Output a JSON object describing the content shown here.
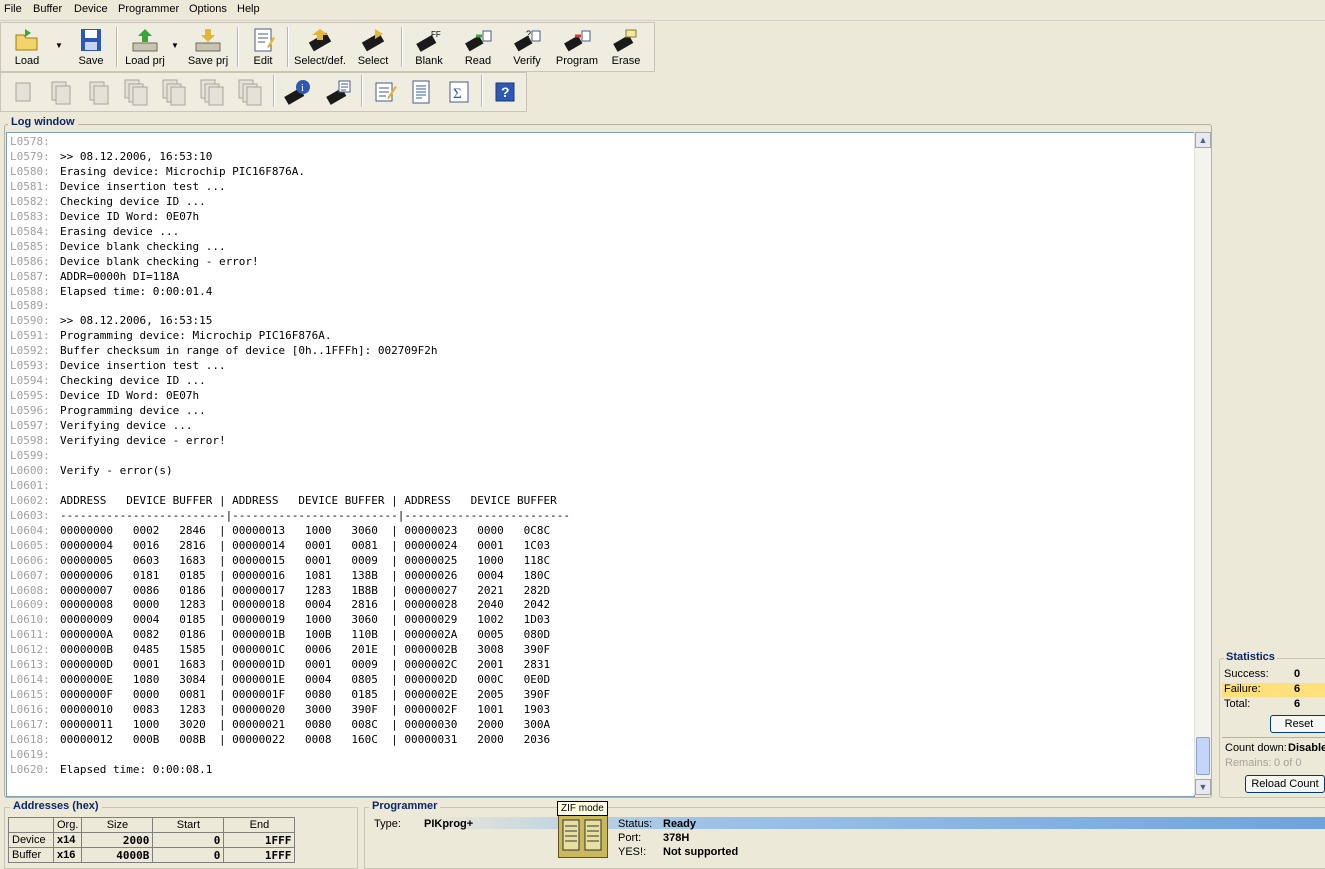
{
  "menu": [
    "File",
    "Buffer",
    "Device",
    "Programmer",
    "Options",
    "Help"
  ],
  "toolbar": {
    "load": "Load",
    "save": "Save",
    "load_prj": "Load prj",
    "save_prj": "Save prj",
    "edit": "Edit",
    "select_def": "Select/def.",
    "select": "Select",
    "blank": "Blank",
    "read": "Read",
    "verify": "Verify",
    "program": "Program",
    "erase": "Erase"
  },
  "colors": {
    "accent_title": "#0a246a",
    "failure_highlight": "#ffe07a",
    "chip": "#1a1a1a",
    "arrow_green": "#3aa63a",
    "save_blue": "#2d58b3"
  },
  "icons": {
    "toolbar2": [
      "page-icon",
      "copy-icon",
      "copy-icon",
      "multi-copy-icon",
      "multi-copy-icon",
      "multi-copy-icon",
      "multi-copy-icon",
      "chip-info-icon",
      "chip-settings-icon",
      "notepad-icon",
      "report-icon",
      "sigma-icon",
      "help-icon"
    ]
  },
  "log": {
    "title": "Log window",
    "lines": [
      {
        "n": "L0578:",
        "t": ""
      },
      {
        "n": "L0579:",
        "t": ">> 08.12.2006, 16:53:10"
      },
      {
        "n": "L0580:",
        "t": "Erasing device: Microchip PIC16F876A."
      },
      {
        "n": "L0581:",
        "t": "Device insertion test ..."
      },
      {
        "n": "L0582:",
        "t": "Checking device ID ..."
      },
      {
        "n": "L0583:",
        "t": "Device ID Word: 0E07h"
      },
      {
        "n": "L0584:",
        "t": "Erasing device ..."
      },
      {
        "n": "L0585:",
        "t": "Device blank checking ..."
      },
      {
        "n": "L0586:",
        "t": "Device blank checking - error!"
      },
      {
        "n": "L0587:",
        "t": "ADDR=0000h DI=118A"
      },
      {
        "n": "L0588:",
        "t": "Elapsed time: 0:00:01.4"
      },
      {
        "n": "L0589:",
        "t": ""
      },
      {
        "n": "L0590:",
        "t": ">> 08.12.2006, 16:53:15"
      },
      {
        "n": "L0591:",
        "t": "Programming device: Microchip PIC16F876A."
      },
      {
        "n": "L0592:",
        "t": "Buffer checksum in range of device [0h..1FFFh]: 002709F2h"
      },
      {
        "n": "L0593:",
        "t": "Device insertion test ..."
      },
      {
        "n": "L0594:",
        "t": "Checking device ID ..."
      },
      {
        "n": "L0595:",
        "t": "Device ID Word: 0E07h"
      },
      {
        "n": "L0596:",
        "t": "Programming device ..."
      },
      {
        "n": "L0597:",
        "t": "Verifying device ..."
      },
      {
        "n": "L0598:",
        "t": "Verifying device - error!"
      },
      {
        "n": "L0599:",
        "t": ""
      },
      {
        "n": "L0600:",
        "t": "Verify - error(s)"
      },
      {
        "n": "L0601:",
        "t": ""
      },
      {
        "n": "L0602:",
        "t": "ADDRESS   DEVICE BUFFER | ADDRESS   DEVICE BUFFER | ADDRESS   DEVICE BUFFER"
      },
      {
        "n": "L0603:",
        "t": "-------------------------|-------------------------|-------------------------"
      },
      {
        "n": "L0604:",
        "t": "00000000   0002   2846  | 00000013   1000   3060  | 00000023   0000   0C8C"
      },
      {
        "n": "L0605:",
        "t": "00000004   0016   2816  | 00000014   0001   0081  | 00000024   0001   1C03"
      },
      {
        "n": "L0606:",
        "t": "00000005   0603   1683  | 00000015   0001   0009  | 00000025   1000   118C"
      },
      {
        "n": "L0607:",
        "t": "00000006   0181   0185  | 00000016   1081   138B  | 00000026   0004   180C"
      },
      {
        "n": "L0608:",
        "t": "00000007   0086   0186  | 00000017   1283   1B8B  | 00000027   2021   282D"
      },
      {
        "n": "L0609:",
        "t": "00000008   0000   1283  | 00000018   0004   2816  | 00000028   2040   2042"
      },
      {
        "n": "L0610:",
        "t": "00000009   0004   0185  | 00000019   1000   3060  | 00000029   1002   1D03"
      },
      {
        "n": "L0611:",
        "t": "0000000A   0082   0186  | 0000001B   100B   110B  | 0000002A   0005   080D"
      },
      {
        "n": "L0612:",
        "t": "0000000B   0485   1585  | 0000001C   0006   201E  | 0000002B   3008   390F"
      },
      {
        "n": "L0613:",
        "t": "0000000D   0001   1683  | 0000001D   0001   0009  | 0000002C   2001   2831"
      },
      {
        "n": "L0614:",
        "t": "0000000E   1080   3084  | 0000001E   0004   0805  | 0000002D   000C   0E0D"
      },
      {
        "n": "L0615:",
        "t": "0000000F   0000   0081  | 0000001F   0080   0185  | 0000002E   2005   390F"
      },
      {
        "n": "L0616:",
        "t": "00000010   0083   1283  | 00000020   3000   390F  | 0000002F   1001   1903"
      },
      {
        "n": "L0617:",
        "t": "00000011   1000   3020  | 00000021   0080   008C  | 00000030   2000   300A"
      },
      {
        "n": "L0618:",
        "t": "00000012   000B   008B  | 00000022   0008   160C  | 00000031   2000   2036"
      },
      {
        "n": "L0619:",
        "t": ""
      },
      {
        "n": "L0620:",
        "t": "Elapsed time: 0:00:08.1"
      }
    ]
  },
  "statistics": {
    "title": "Statistics",
    "success_label": "Success:",
    "success_value": "0",
    "failure_label": "Failure:",
    "failure_value": "6",
    "total_label": "Total:",
    "total_value": "6",
    "reset": "Reset",
    "countdown_label": "Count down:",
    "countdown_value": "Disable",
    "remains_label": "Remains:",
    "remains_value": "0 of 0",
    "reload_count": "Reload Count"
  },
  "addresses": {
    "title": "Addresses (hex)",
    "headers": [
      "",
      "Org.",
      "Size",
      "Start",
      "End"
    ],
    "rows": [
      [
        "Device",
        "x14",
        "2000",
        "0",
        "1FFF"
      ],
      [
        "Buffer",
        "x16",
        "4000B",
        "0",
        "1FFF"
      ]
    ]
  },
  "programmer": {
    "title": "Programmer",
    "type_label": "Type:",
    "type_value": "PIKprog+",
    "status_label": "Status:",
    "status_value": "Ready",
    "port_label": "Port:",
    "port_value": "378H",
    "yes_label": "YES!:",
    "yes_value": "Not supported",
    "zif_tooltip": "ZIF mode"
  }
}
